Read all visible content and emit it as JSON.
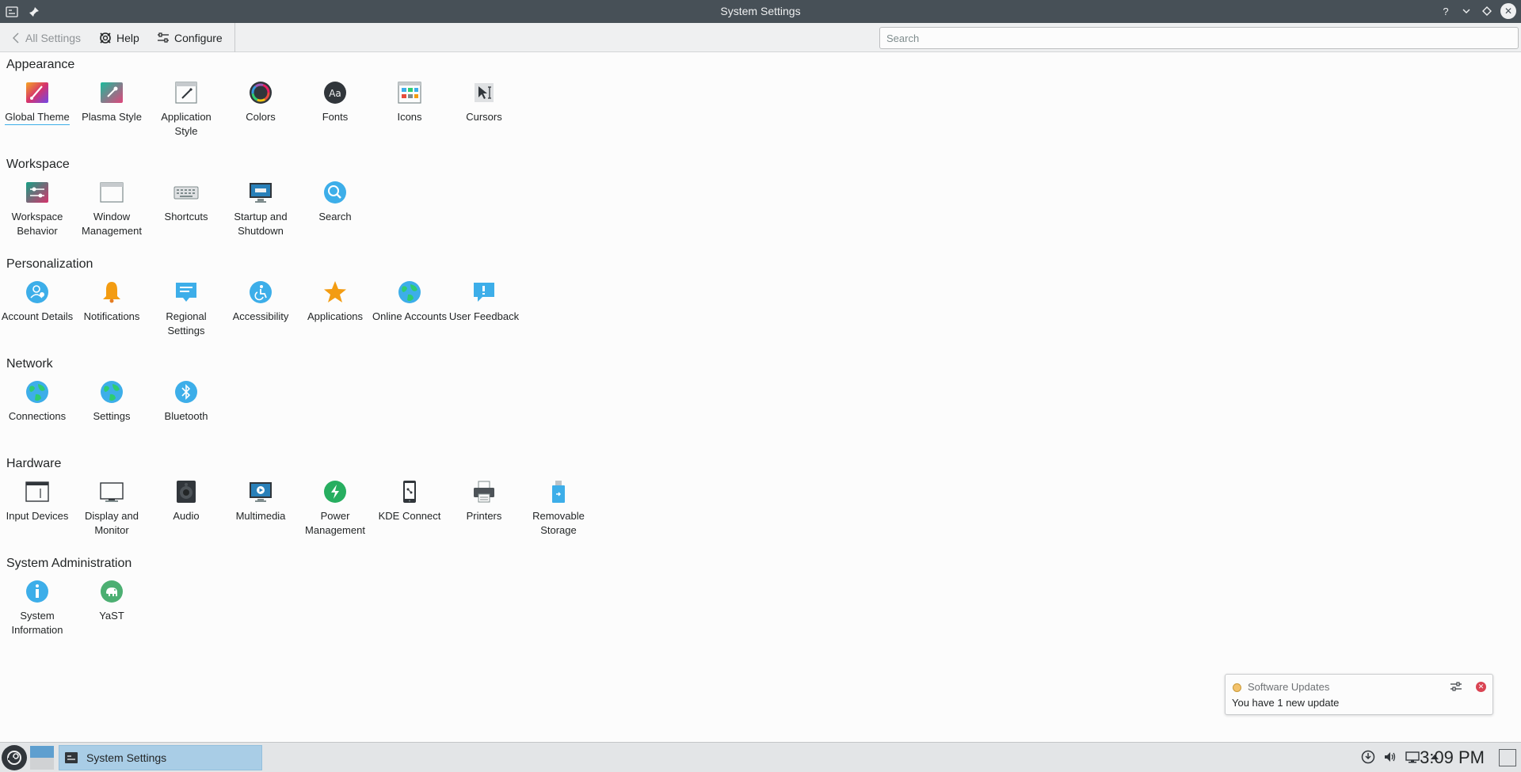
{
  "window": {
    "title": "System Settings"
  },
  "toolbar": {
    "back_label": "All Settings",
    "help_label": "Help",
    "configure_label": "Configure",
    "search_placeholder": "Search"
  },
  "sections": [
    {
      "title": "Appearance",
      "items": [
        {
          "label": "Global Theme",
          "icon": "global-theme-icon"
        },
        {
          "label": "Plasma Style",
          "icon": "plasma-style-icon"
        },
        {
          "label": "Application Style",
          "icon": "application-style-icon"
        },
        {
          "label": "Colors",
          "icon": "colors-icon"
        },
        {
          "label": "Fonts",
          "icon": "fonts-icon"
        },
        {
          "label": "Icons",
          "icon": "icons-icon"
        },
        {
          "label": "Cursors",
          "icon": "cursors-icon"
        }
      ]
    },
    {
      "title": "Workspace",
      "items": [
        {
          "label": "Workspace Behavior",
          "icon": "workspace-behavior-icon"
        },
        {
          "label": "Window Management",
          "icon": "window-management-icon"
        },
        {
          "label": "Shortcuts",
          "icon": "keyboard-icon"
        },
        {
          "label": "Startup and Shutdown",
          "icon": "startup-shutdown-icon"
        },
        {
          "label": "Search",
          "icon": "search-icon"
        }
      ]
    },
    {
      "title": "Personalization",
      "items": [
        {
          "label": "Account Details",
          "icon": "account-icon"
        },
        {
          "label": "Notifications",
          "icon": "bell-icon"
        },
        {
          "label": "Regional Settings",
          "icon": "regional-settings-icon"
        },
        {
          "label": "Accessibility",
          "icon": "accessibility-icon"
        },
        {
          "label": "Applications",
          "icon": "star-icon"
        },
        {
          "label": "Online Accounts",
          "icon": "globe-icon"
        },
        {
          "label": "User Feedback",
          "icon": "feedback-icon"
        }
      ]
    },
    {
      "title": "Network",
      "items": [
        {
          "label": "Connections",
          "icon": "globe-icon"
        },
        {
          "label": "Settings",
          "icon": "globe-icon"
        },
        {
          "label": "Bluetooth",
          "icon": "bluetooth-icon"
        }
      ]
    },
    {
      "title": "Hardware",
      "items": [
        {
          "label": "Input Devices",
          "icon": "input-devices-icon"
        },
        {
          "label": "Display and Monitor",
          "icon": "monitor-icon"
        },
        {
          "label": "Audio",
          "icon": "speaker-icon"
        },
        {
          "label": "Multimedia",
          "icon": "multimedia-icon"
        },
        {
          "label": "Power Management",
          "icon": "power-icon"
        },
        {
          "label": "KDE Connect",
          "icon": "phone-icon"
        },
        {
          "label": "Printers",
          "icon": "printer-icon"
        },
        {
          "label": "Removable Storage",
          "icon": "usb-icon"
        }
      ]
    },
    {
      "title": "System Administration",
      "items": [
        {
          "label": "System Information",
          "icon": "info-icon"
        },
        {
          "label": "YaST",
          "icon": "yast-icon"
        }
      ]
    }
  ],
  "notification": {
    "title": "Software Updates",
    "body": "You have 1 new update"
  },
  "taskbar": {
    "task_label": "System Settings",
    "clock": "3:09 PM"
  },
  "colors": {
    "accent": "#3daee9",
    "titlebar": "#475057",
    "task_active": "#a9cde6"
  }
}
